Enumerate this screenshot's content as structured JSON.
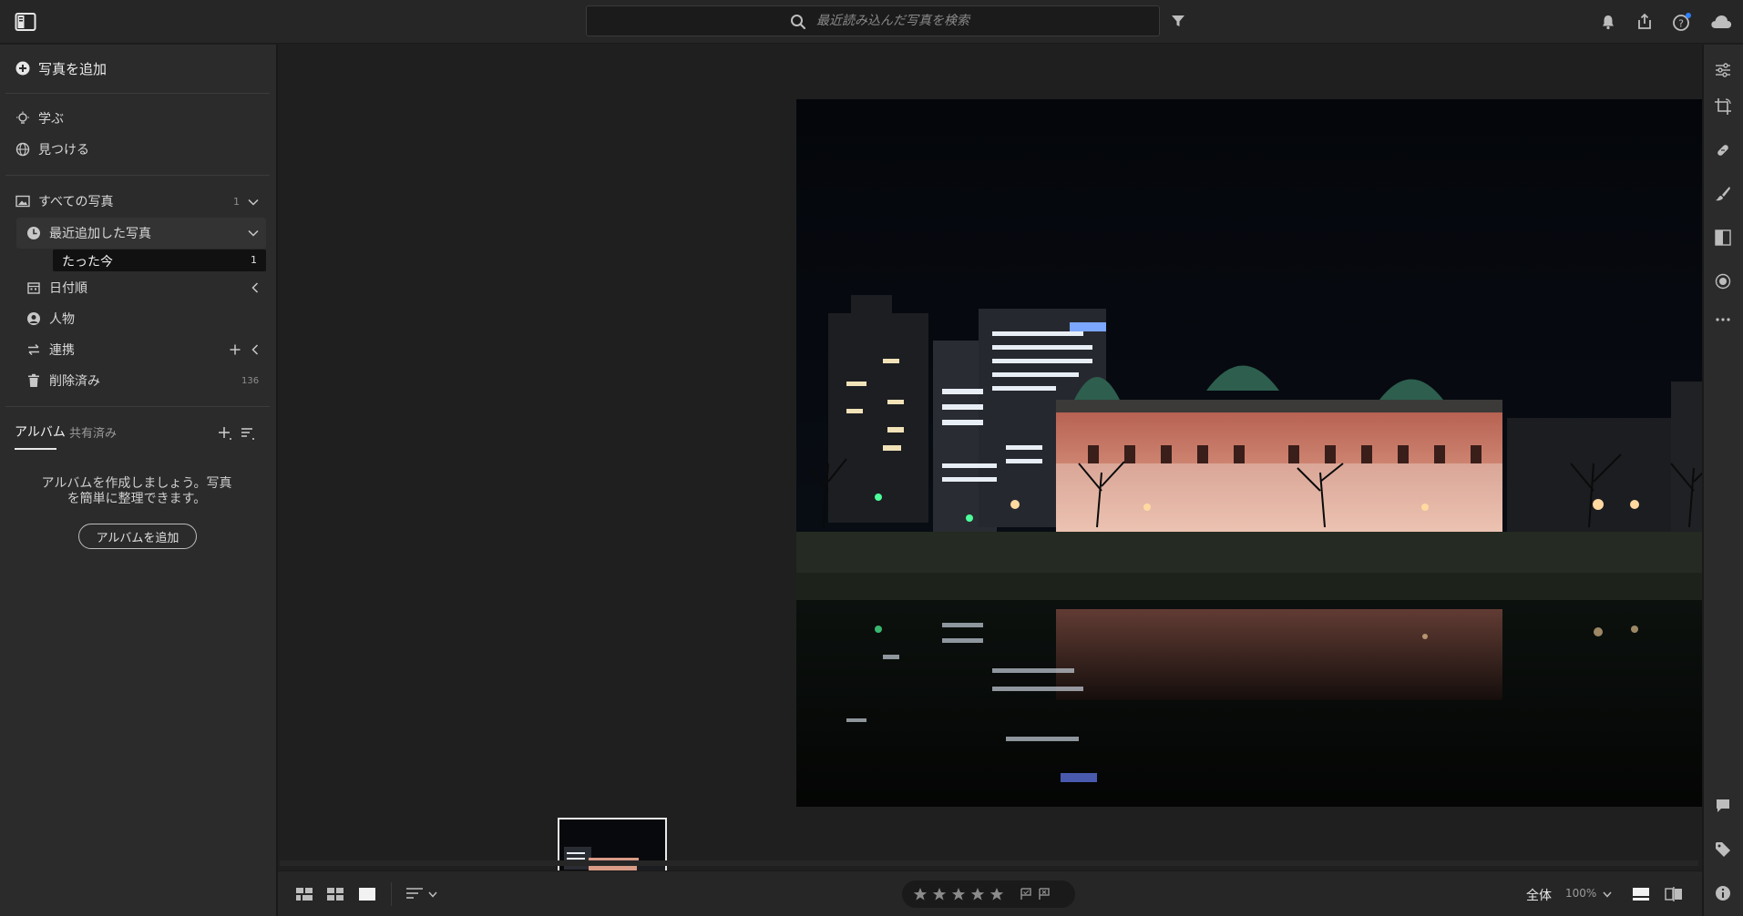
{
  "topbar": {
    "search_placeholder": "最近読み込んだ写真を検索"
  },
  "sidebar": {
    "add_photos": "写真を追加",
    "learn": "学ぶ",
    "discover": "見つける",
    "all_photos": {
      "label": "すべての写真",
      "count": "1"
    },
    "recently_added": {
      "label": "最近追加した写真"
    },
    "just_now": {
      "label": "たった今",
      "count": "1"
    },
    "by_date": "日付順",
    "people": "人物",
    "connections": "連携",
    "deleted": {
      "label": "削除済み",
      "count": "136"
    },
    "tabs": {
      "albums": "アルバム",
      "shared": "共有済み"
    },
    "empty_text_line1": "アルバムを作成しましょう。写真",
    "empty_text_line2": "を簡単に整理できます。",
    "add_album_button": "アルバムを追加"
  },
  "bottombar": {
    "fit_label": "全体",
    "zoom_label": "100%",
    "rating_stars": 0,
    "rating_max": 5
  },
  "colors": {
    "accent_badge": "#2d7ff9",
    "selection_bg": "#111111",
    "panel_bg": "#2b2b2b"
  },
  "icons": {
    "top_right": [
      "bell-icon",
      "share-icon",
      "help-icon",
      "cloud-icon"
    ],
    "right_panel": [
      "edit-sliders-icon",
      "crop-icon",
      "healing-icon",
      "brush-icon",
      "linear-gradient-icon",
      "radial-gradient-icon",
      "more-icon",
      "comment-icon",
      "keyword-tag-icon",
      "info-icon"
    ]
  }
}
